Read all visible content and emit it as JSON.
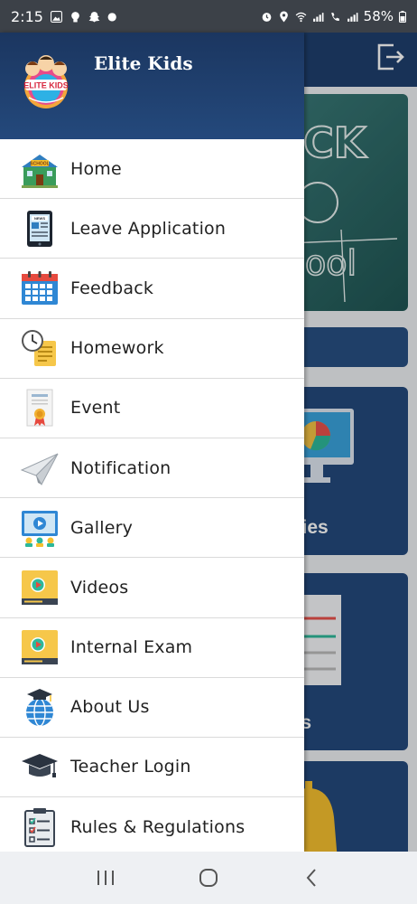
{
  "status": {
    "time": "2:15",
    "battery": "58%"
  },
  "drawer": {
    "brand": "Elite Kids",
    "logo_text": "ELITE KIDS",
    "items": [
      {
        "label": "Home",
        "icon": "school-icon"
      },
      {
        "label": "Leave Application",
        "icon": "tablet-news-icon"
      },
      {
        "label": "Feedback",
        "icon": "calendar-icon"
      },
      {
        "label": "Homework",
        "icon": "clock-notes-icon"
      },
      {
        "label": "Event",
        "icon": "certificate-icon"
      },
      {
        "label": "Notification",
        "icon": "paper-plane-icon"
      },
      {
        "label": "Gallery",
        "icon": "gallery-screen-icon"
      },
      {
        "label": "Videos",
        "icon": "video-player-icon"
      },
      {
        "label": "Internal Exam",
        "icon": "video-player-icon"
      },
      {
        "label": "About Us",
        "icon": "globe-graduation-icon"
      },
      {
        "label": "Teacher Login",
        "icon": "graduation-cap-icon"
      },
      {
        "label": "Rules & Regulations",
        "icon": "clipboard-checklist-icon"
      }
    ]
  },
  "background": {
    "board_text": "CK ool",
    "facilities_label": "ilities",
    "fees_label": "ees"
  },
  "colors": {
    "header": "#24497c",
    "status_bar": "#3c4148"
  }
}
